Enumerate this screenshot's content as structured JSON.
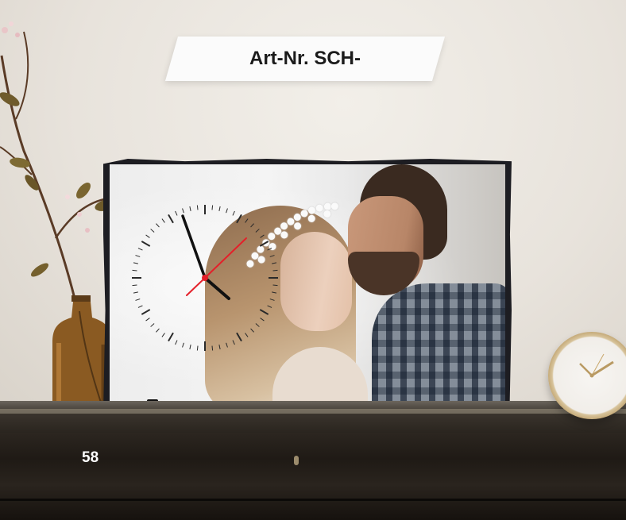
{
  "header": {
    "article_label": "Art-Nr. SCH-"
  },
  "footer": {
    "page_number": "58"
  },
  "colors": {
    "banner_background": "#fbfbfb",
    "title_text": "#1b1b1b",
    "page_number_text": "#ffffff",
    "clock_second_hand": "#e4202a"
  },
  "icons": {
    "wall_clock": "clock-icon",
    "table_clock": "alarm-clock-icon"
  }
}
